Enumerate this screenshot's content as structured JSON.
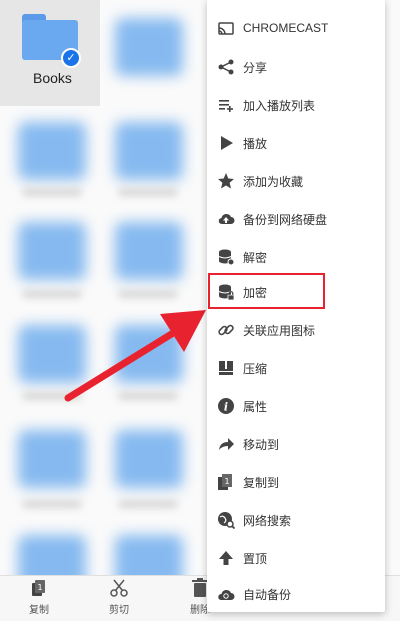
{
  "selected_folder": {
    "name": "Books"
  },
  "menu": {
    "items": [
      {
        "label": "CHROMECAST",
        "icon": "cast-icon"
      },
      {
        "label": "分享",
        "icon": "share-icon"
      },
      {
        "label": "加入播放列表",
        "icon": "add-to-playlist-icon"
      },
      {
        "label": "播放",
        "icon": "play-icon"
      },
      {
        "label": "添加为收藏",
        "icon": "star-icon"
      },
      {
        "label": "备份到网络硬盘",
        "icon": "cloud-upload-icon"
      },
      {
        "label": "解密",
        "icon": "database-unlock-icon"
      },
      {
        "label": "加密",
        "icon": "database-lock-icon"
      },
      {
        "label": "关联应用图标",
        "icon": "link-icon"
      },
      {
        "label": "压缩",
        "icon": "archive-icon"
      },
      {
        "label": "属性",
        "icon": "info-icon"
      },
      {
        "label": "移动到",
        "icon": "forward-icon"
      },
      {
        "label": "复制到",
        "icon": "copy-to-icon"
      },
      {
        "label": "网络搜索",
        "icon": "web-search-icon"
      },
      {
        "label": "置顶",
        "icon": "pin-top-icon"
      },
      {
        "label": "自动备份",
        "icon": "cloud-sync-icon"
      }
    ],
    "highlighted_item": "加密",
    "highlight_color": "#e8232f"
  },
  "toolbar": {
    "copy_label": "复制",
    "cut_label": "剪切",
    "delete_label": "删除"
  },
  "colors": {
    "accent": "#1a73e8",
    "folder": "#6aa8f0",
    "arrow": "#e8232f"
  }
}
